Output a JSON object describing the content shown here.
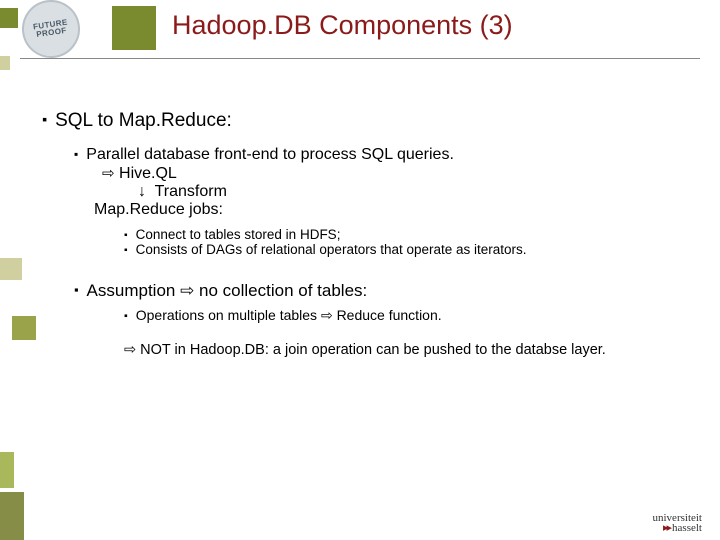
{
  "badge": {
    "line1": "FUTURE",
    "line2": "PROOF"
  },
  "title": "Hadoop.DB Components (3)",
  "main": {
    "heading": "SQL to Map.Reduce:",
    "front_end": "Parallel database front-end to process SQL queries.",
    "hiveql_arrow": "⇨",
    "hiveql": "Hive.QL",
    "transform_arrow": "↓",
    "transform": "Transform",
    "mr_jobs": "Map.Reduce jobs:",
    "detail1": "Connect to tables stored in HDFS;",
    "detail2": "Consists of DAGs of relational operators that operate as iterators.",
    "assumption": "Assumption ⇨ no collection of tables:",
    "assumption_detail": "Operations on multiple tables ⇨ Reduce function.",
    "note": "⇨ NOT in Hadoop.DB: a join operation can be pushed to the databse layer."
  },
  "footer": {
    "uni": "universiteit",
    "hassel": "hasselt"
  }
}
